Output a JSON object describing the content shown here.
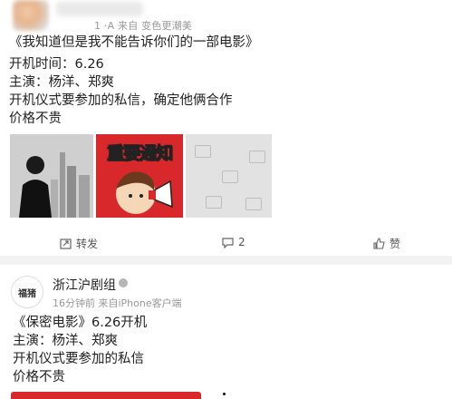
{
  "post1": {
    "meta": "1 ·A 来自 变色更潮美",
    "title": "《我知道但是我不能告诉你们的一部电影》",
    "line2": "开机时间：6.26",
    "line3": "主演：杨洋、郑爽",
    "line4": "开机仪式要参加的私信，确定他俩合作",
    "line5": "价格不贵",
    "notice_text": "重要通知",
    "actions": {
      "repost": "转发",
      "comment": "2",
      "like": "赞"
    }
  },
  "post2": {
    "avatar_text": "福猪",
    "name": "浙江沪剧组",
    "meta": "16分钟前  来自iPhone客户端",
    "line1": "《保密电影》6.26开机",
    "line2": "主演：杨洋、郑爽",
    "line3": "开机仪式要参加的私信",
    "line4": "价格不贵"
  },
  "colors": {
    "brand_red": "#d8282c",
    "meta_gray": "#999999",
    "bg": "#f2f2f2"
  }
}
